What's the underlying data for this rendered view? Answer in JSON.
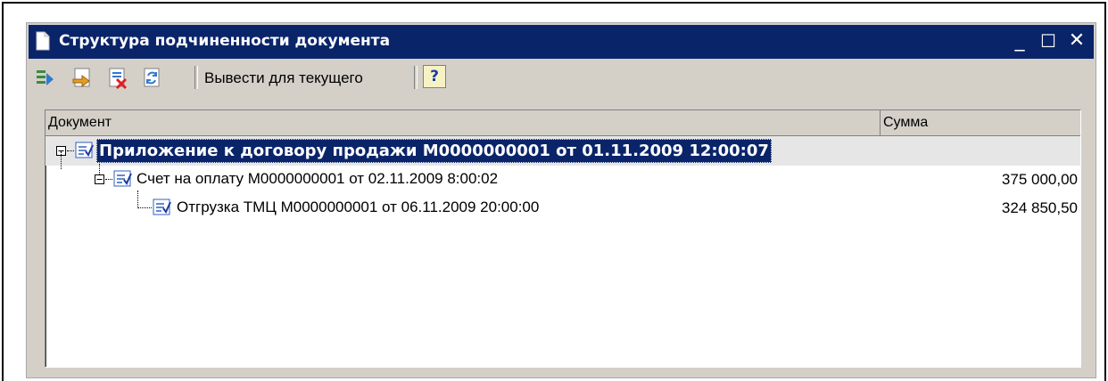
{
  "window": {
    "title": "Структура подчиненности документа",
    "minimize_glyph": "_",
    "maximize_glyph": "☐",
    "close_glyph": "✕"
  },
  "toolbar": {
    "buttons": [
      {
        "icon": "tree-arrow-icon"
      },
      {
        "icon": "open-document-icon"
      },
      {
        "icon": "document-delete-icon"
      },
      {
        "icon": "refresh-icon"
      }
    ],
    "show_for_current_label": "Вывести для текущего",
    "help_label": "?"
  },
  "grid": {
    "columns": [
      "Документ",
      "Сумма"
    ],
    "rows": [
      {
        "level": 0,
        "text": "Приложение к договору продажи М0000000001 от 01.11.2009 12:00:07",
        "sum": "",
        "selected": true,
        "expander": "minus"
      },
      {
        "level": 1,
        "text": "Счет на оплату М0000000001 от 02.11.2009 8:00:02",
        "sum": "375 000,00",
        "selected": false,
        "expander": "minus"
      },
      {
        "level": 2,
        "text": "Отгрузка ТМЦ М0000000001 от 06.11.2009 20:00:00",
        "sum": "324 850,50",
        "selected": false,
        "expander": "none"
      }
    ]
  },
  "colors": {
    "title_bar": "#0a246a",
    "window_bg": "#d4d0c8",
    "selection": "#0a246a"
  }
}
